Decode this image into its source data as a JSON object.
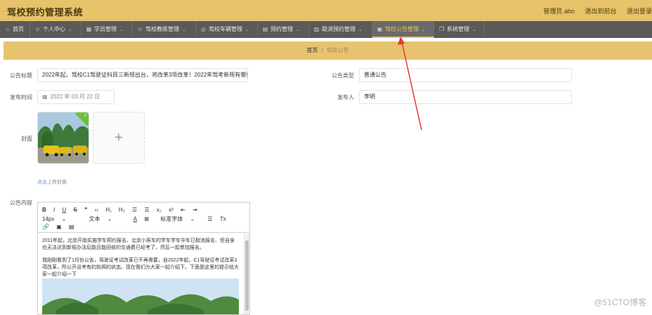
{
  "header": {
    "app_title": "驾校预约管理系统",
    "links": [
      "管理员 abo",
      "退出到前台",
      "退出登录"
    ]
  },
  "nav": {
    "items": [
      {
        "label": "首页",
        "icon": "home-icon",
        "glyph": "⌂",
        "caret": ""
      },
      {
        "label": "个人中心",
        "icon": "user-icon",
        "glyph": "☺",
        "caret": "⌄"
      },
      {
        "label": "学员管理",
        "icon": "student-icon",
        "glyph": "▦",
        "caret": "⌄"
      },
      {
        "label": "驾校教练管理",
        "icon": "coach-icon",
        "glyph": "☺",
        "caret": "⌄"
      },
      {
        "label": "驾校车辆管理",
        "icon": "car-icon",
        "glyph": "◎",
        "caret": "⌄"
      },
      {
        "label": "预约管理",
        "icon": "booking-icon",
        "glyph": "▤",
        "caret": "⌄"
      },
      {
        "label": "取消预约管理",
        "icon": "cancel-icon",
        "glyph": "▥",
        "caret": "⌄"
      },
      {
        "label": "驾校公告管理",
        "icon": "notice-icon",
        "glyph": "▣",
        "caret": "⌄"
      },
      {
        "label": "系统管理",
        "icon": "settings-icon",
        "glyph": "❐",
        "caret": "⌄"
      }
    ],
    "active_index": 7
  },
  "breadcrumb": {
    "home": "首页",
    "separator": "/",
    "current": "驾校公告"
  },
  "form": {
    "title_label": "公告标题",
    "title_value": "2022年起，驾校C1驾驶证科目三新规出台，将改革3项改革！2022年驾考新规有哪些_",
    "type_label": "公告类型",
    "type_value": "普通公告",
    "time_label": "发布时间",
    "time_value": "2022 年 03 月 22 日",
    "publisher_label": "发布人",
    "publisher_value": "李明",
    "cover_label": "封面",
    "cover_hint_highlight": "点击",
    "cover_hint_rest": "上传封面",
    "upload_plus": "+",
    "upload_check": "✓",
    "content_label": "公告内容"
  },
  "editor": {
    "toolbar_row1": [
      "B",
      "I",
      "U",
      "S",
      "❞",
      "‹›",
      "H₁",
      "H₂",
      "☰",
      "☰",
      "x₂",
      "x²",
      "⇤",
      "⇥"
    ],
    "font_size": "14px",
    "font_size_caret": "⌄",
    "text_style": "文本",
    "text_style_caret": "⌄",
    "color_a": "A",
    "color_bg": "⊠",
    "font_family": "标准字体",
    "font_family_caret": "⌄",
    "align_icon": "☰",
    "clear_format": "Tx",
    "toolbar_row3": [
      "🔗",
      "▣",
      "▤"
    ],
    "paragraph1": "2011年起，北京开始实施学车预约报名、北京小客车的学车学车中车已取消报名、但自身也无法达到新规办法后能且能回收的交通费已经考了，然后一起参加报名。",
    "paragraph2": "我刚刚看到了1月份公告，驾驶证考试改革已不再需要，自2022年起，C1驾驶证考试改革3项改革，所以开设考有的执照的状态。现在我们为大家一起介绍下。下面是这里的提示给大家一起介绍一下"
  },
  "watermark": "@51CTO博客",
  "colors": {
    "accent": "#e6c26a",
    "nav_bg": "#5a5a5a",
    "success": "#67c23a",
    "annotation_arrow": "#e53935"
  }
}
